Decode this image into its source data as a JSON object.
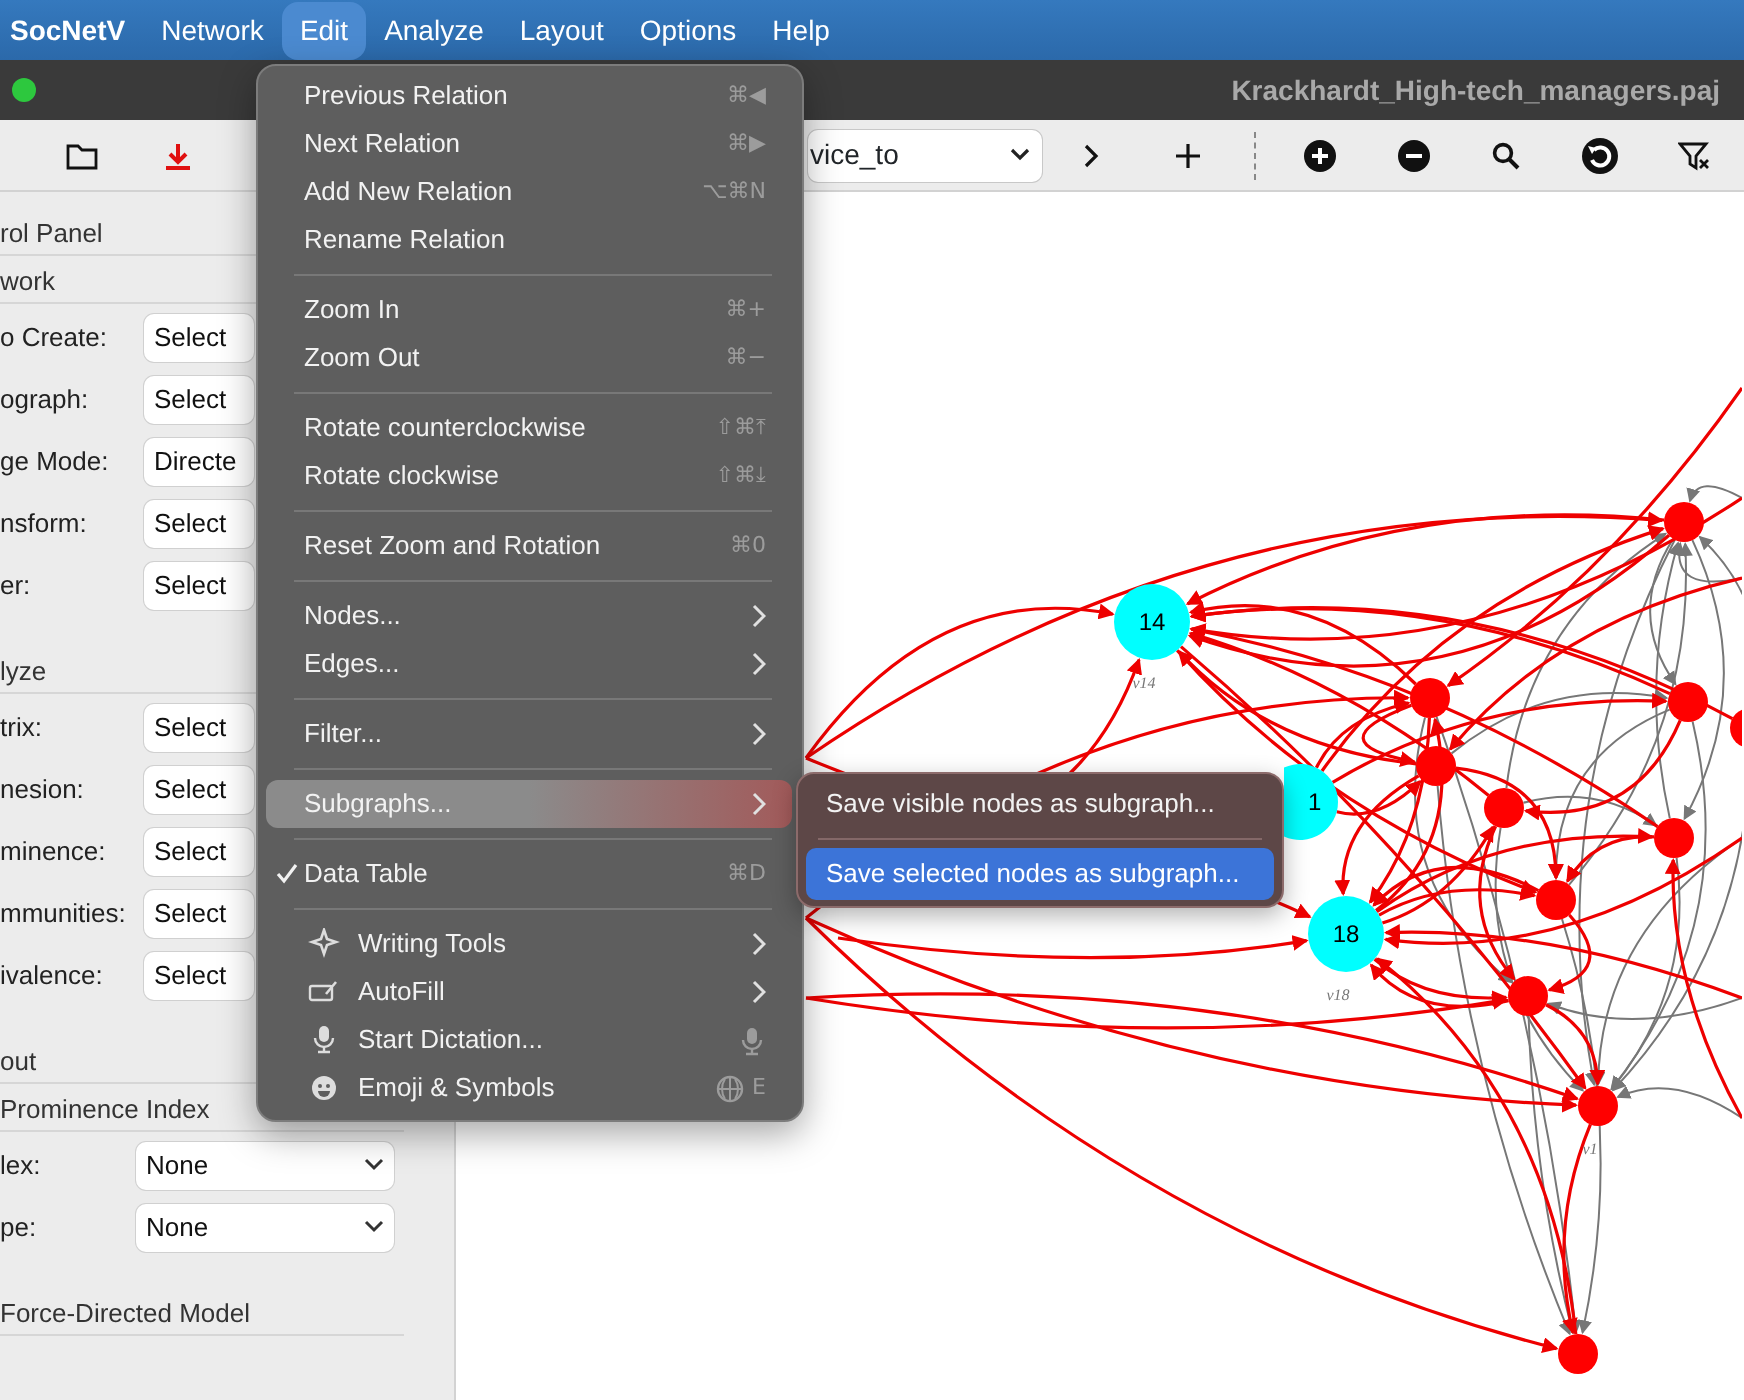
{
  "menu_bar": {
    "app_name": "SocNetV",
    "items": [
      {
        "label": "Network",
        "selected": false
      },
      {
        "label": "Edit",
        "selected": true
      },
      {
        "label": "Analyze",
        "selected": false
      },
      {
        "label": "Layout",
        "selected": false
      },
      {
        "label": "Options",
        "selected": false
      },
      {
        "label": "Help",
        "selected": false
      }
    ]
  },
  "window": {
    "title": "Krackhardt_High-tech_managers.paj"
  },
  "toolbar": {
    "relation_select": {
      "value": "vice_to"
    }
  },
  "control_panel": {
    "title": "rol Panel",
    "sections": [
      {
        "title": "work",
        "rows": [
          {
            "label": "o Create:",
            "value": "Select",
            "kind": "button"
          },
          {
            "label": "ograph:",
            "value": "Select",
            "kind": "button"
          },
          {
            "label": "ge Mode:",
            "value": "Directe",
            "kind": "button"
          },
          {
            "label": "nsform:",
            "value": "Select",
            "kind": "button"
          },
          {
            "label": "er:",
            "value": "Select",
            "kind": "button"
          }
        ]
      },
      {
        "title": "lyze",
        "rows": [
          {
            "label": "trix:",
            "value": "Select",
            "kind": "button"
          },
          {
            "label": "nesion:",
            "value": "Select",
            "kind": "button"
          },
          {
            "label": "minence:",
            "value": "Select",
            "kind": "button"
          },
          {
            "label": "mmunities:",
            "value": "Select",
            "kind": "button"
          },
          {
            "label": "ivalence:",
            "value": "Select",
            "kind": "button"
          }
        ]
      },
      {
        "title": "out"
      },
      {
        "title": "Prominence Index",
        "rows": [
          {
            "label": "lex:",
            "value": "None",
            "kind": "dropdown"
          },
          {
            "label": "pe:",
            "value": "None",
            "kind": "dropdown"
          }
        ]
      },
      {
        "title": "Force-Directed Model"
      }
    ]
  },
  "edit_menu": {
    "items": [
      {
        "kind": "item",
        "label": "Previous Relation",
        "shortcut": "⌘◀",
        "checked": false,
        "selected": false
      },
      {
        "kind": "item",
        "label": "Next Relation",
        "shortcut": "⌘▶",
        "checked": false,
        "selected": false
      },
      {
        "kind": "item",
        "label": "Add New Relation",
        "shortcut": "⌥⌘N",
        "checked": false,
        "selected": false
      },
      {
        "kind": "item",
        "label": "Rename Relation",
        "checked": false,
        "selected": false
      },
      {
        "kind": "separator"
      },
      {
        "kind": "item",
        "label": "Zoom In",
        "shortcut": "⌘+",
        "checked": false,
        "selected": false
      },
      {
        "kind": "item",
        "label": "Zoom Out",
        "shortcut": "⌘−",
        "checked": false,
        "selected": false
      },
      {
        "kind": "separator"
      },
      {
        "kind": "item",
        "label": "Rotate counterclockwise",
        "shortcut": "⇧⌘⤒",
        "checked": false,
        "selected": false
      },
      {
        "kind": "item",
        "label": "Rotate clockwise",
        "shortcut": "⇧⌘⤓",
        "checked": false,
        "selected": false
      },
      {
        "kind": "separator"
      },
      {
        "kind": "item",
        "label": "Reset Zoom and Rotation",
        "shortcut": "⌘0",
        "checked": false,
        "selected": false
      },
      {
        "kind": "separator"
      },
      {
        "kind": "item",
        "label": "Nodes...",
        "submenu": true,
        "checked": false,
        "selected": false
      },
      {
        "kind": "item",
        "label": "Edges...",
        "submenu": true,
        "checked": false,
        "selected": false
      },
      {
        "kind": "separator"
      },
      {
        "kind": "item",
        "label": "Filter...",
        "submenu": true,
        "checked": false,
        "selected": false
      },
      {
        "kind": "separator"
      },
      {
        "kind": "item",
        "label": "Subgraphs...",
        "submenu": true,
        "checked": false,
        "selected": true
      },
      {
        "kind": "separator"
      },
      {
        "kind": "item",
        "label": "Data Table",
        "shortcut": "⌘D",
        "checked": true,
        "selected": false
      },
      {
        "kind": "separator"
      },
      {
        "kind": "icon_item",
        "label": "Writing Tools",
        "submenu": true,
        "checked": false,
        "selected": false
      },
      {
        "kind": "icon_item",
        "label": "AutoFill",
        "submenu": true,
        "checked": false,
        "selected": false
      },
      {
        "kind": "icon_item",
        "label": "Start Dictation...",
        "shortcut_icon": true,
        "checked": false,
        "selected": false
      },
      {
        "kind": "icon_item",
        "label": "Emoji & Symbols",
        "shortcut": "E",
        "shortcut_icon": true,
        "checked": false,
        "selected": false
      }
    ]
  },
  "subgraphs_submenu": {
    "items": [
      {
        "kind": "item",
        "label": "Save visible nodes as subgraph...",
        "selected": false
      },
      {
        "kind": "separator"
      },
      {
        "kind": "item",
        "label": "Save selected nodes as subgraph...",
        "selected": true
      }
    ]
  },
  "graph": {
    "nodes": [
      {
        "label": "14",
        "caption": "v14",
        "color": "#00ffff"
      },
      {
        "label": "1",
        "color": "#00ffff"
      },
      {
        "label": "18",
        "caption": "v18",
        "color": "#00ffff"
      },
      {
        "color": "#ff0000"
      },
      {
        "color": "#ff0000"
      },
      {
        "color": "#ff0000"
      },
      {
        "color": "#ff0000"
      },
      {
        "color": "#ff0000"
      },
      {
        "color": "#ff0000"
      },
      {
        "color": "#ff0000"
      },
      {
        "color": "#ff0000"
      },
      {
        "caption": "v1",
        "color": "#ff0000"
      },
      {
        "color": "#ff0000"
      },
      {
        "color": "#ff0000"
      }
    ]
  }
}
